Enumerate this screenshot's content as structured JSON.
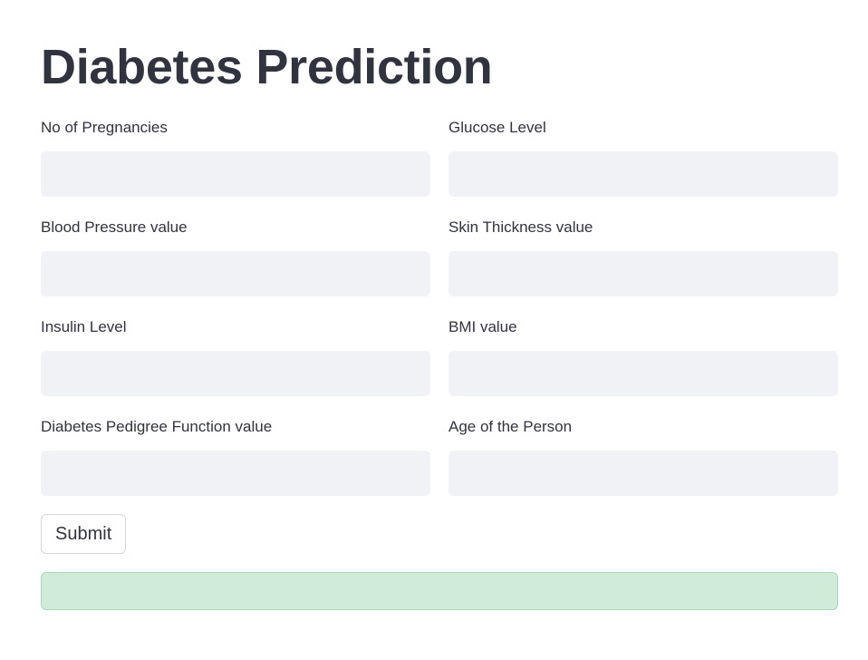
{
  "page": {
    "title": "Diabetes Prediction"
  },
  "form": {
    "fields": [
      {
        "label": "No of Pregnancies",
        "value": ""
      },
      {
        "label": "Glucose Level",
        "value": ""
      },
      {
        "label": "Blood Pressure value",
        "value": ""
      },
      {
        "label": "Skin Thickness value",
        "value": ""
      },
      {
        "label": "Insulin Level",
        "value": ""
      },
      {
        "label": "BMI value",
        "value": ""
      },
      {
        "label": "Diabetes Pedigree Function value",
        "value": ""
      },
      {
        "label": "Age of the Person",
        "value": ""
      }
    ],
    "submit_label": "Submit"
  },
  "result": {
    "message": ""
  },
  "colors": {
    "text": "#31333f",
    "input_background": "#f0f2f6",
    "success_background": "#d0ecd9",
    "success_border": "#a8dab9"
  }
}
